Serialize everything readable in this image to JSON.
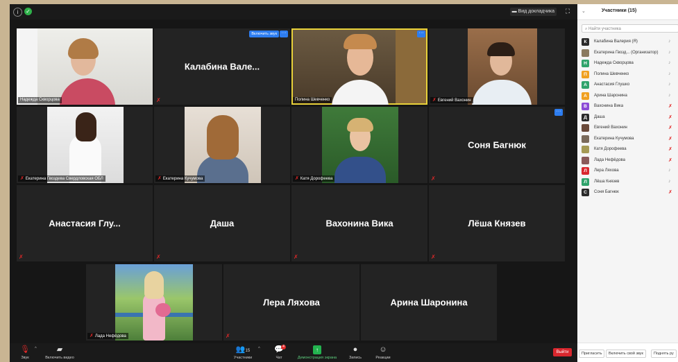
{
  "window": {
    "speaker_view_label": "Вид докладчика",
    "fullscreen_icon": "fullscreen-icon"
  },
  "tiles": {
    "skvortsova": {
      "name": "Надежда Скворцова"
    },
    "kalabina": {
      "display": "Калабина Вале...",
      "unmute": "Включить звук"
    },
    "shevchenko": {
      "name": "Полина Шевченко"
    },
    "vakhonin": {
      "name": "Евгений Вахонин"
    },
    "gvozdeva": {
      "name": "Екатерина Гвоздева Свердловская ОБЛ"
    },
    "kuchumova": {
      "name": "Екатерина Кучумова"
    },
    "dorofeeva": {
      "name": "Катя Дорофеева"
    },
    "bagnyuk": {
      "display": "Соня Багнюк"
    },
    "glushko": {
      "display": "Анастасия Глу..."
    },
    "dasha": {
      "display": "Даша"
    },
    "vakhonina": {
      "display": "Вахонина Вика"
    },
    "knyazev": {
      "display": "Лёша Князев"
    },
    "nefedova": {
      "name": "Лада Нефёдова"
    },
    "lyakhova": {
      "display": "Лера Ляхова"
    },
    "sharonina": {
      "display": "Арина Шаронина"
    }
  },
  "toolbar": {
    "audio": "Звук",
    "video": "Включить видео",
    "participants": "Участники",
    "participants_count": "15",
    "chat": "Чат",
    "chat_badge": "4",
    "share": "Демонстрация экрана",
    "record": "Запись",
    "reactions": "Реакции",
    "leave": "Выйти"
  },
  "panel": {
    "title": "Участники (15)",
    "search_placeholder": "Найти участника",
    "participants": [
      {
        "initial": "К",
        "name": "Калабина Валерия (Я)",
        "color": "#2b2b2b"
      },
      {
        "initial": "",
        "name": "Екатерина Гвозд... (Организатор)",
        "color": "#8a7a60"
      },
      {
        "initial": "Н",
        "name": "Надежда Скворцова",
        "color": "#2fa36b"
      },
      {
        "initial": "П",
        "name": "Полина Шевченко",
        "color": "#f0a020"
      },
      {
        "initial": "А",
        "name": "Анастасия Глушко",
        "color": "#2fa36b"
      },
      {
        "initial": "А",
        "name": "Арина Шаронина",
        "color": "#f0a020"
      },
      {
        "initial": "В",
        "name": "Вахонина Вика",
        "color": "#8b4ad6"
      },
      {
        "initial": "Д",
        "name": "Даша",
        "color": "#2b2b2b"
      },
      {
        "initial": "",
        "name": "Евгений Вахонин",
        "color": "#6a4a3a"
      },
      {
        "initial": "",
        "name": "Екатерина Кучумова",
        "color": "#7a6a5a"
      },
      {
        "initial": "",
        "name": "Катя Дорофеева",
        "color": "#a59a55"
      },
      {
        "initial": "",
        "name": "Лада Нефёдова",
        "color": "#8a5a5a"
      },
      {
        "initial": "Л",
        "name": "Лера Ляхова",
        "color": "#d9272e"
      },
      {
        "initial": "Л",
        "name": "Лёша Князев",
        "color": "#2fa36b"
      },
      {
        "initial": "С",
        "name": "Соня Багнюк",
        "color": "#2b2b2b"
      }
    ],
    "footer": {
      "invite": "Пригласить",
      "unmute_me": "Включить свой звук",
      "raise_hand": "Поднять ру"
    }
  }
}
